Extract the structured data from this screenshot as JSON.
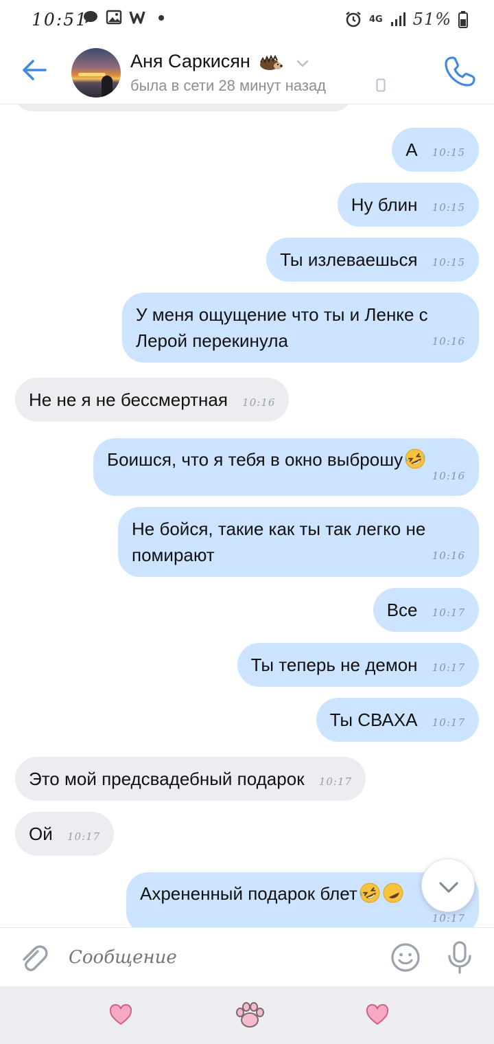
{
  "status_bar": {
    "time": "10:51",
    "network": "4G",
    "battery": "51%",
    "icons": [
      "message-icon",
      "gallery-icon",
      "w-icon",
      "dot-icon",
      "alarm-icon",
      "signal-icon",
      "battery-icon"
    ]
  },
  "header": {
    "contact_name": "Аня Саркисян",
    "name_emoji": "hedgehog-emoji",
    "status": "была в сети 28 минут назад",
    "accent_color": "#3f8ae0"
  },
  "messages": [
    {
      "dir": "out",
      "text": "А",
      "time": "10:15"
    },
    {
      "dir": "out",
      "text": "Ну блин",
      "time": "10:15"
    },
    {
      "dir": "out",
      "text": "Ты излеваешься",
      "time": "10:15"
    },
    {
      "dir": "out",
      "text_line1": "У меня ощущение что ты и Ленке с",
      "text_line2": "Лерой перекинула",
      "time": "10:16"
    },
    {
      "dir": "in",
      "text": "Не не я не бессмертная",
      "time": "10:16"
    },
    {
      "dir": "out",
      "text": "Боишся, что я тебя в окно выброшу",
      "emoji": "rofl-emoji",
      "time": "10:16"
    },
    {
      "dir": "out",
      "text_line1": "Не бойся, такие как ты так легко не",
      "text_line2": "помирают",
      "time": "10:16"
    },
    {
      "dir": "out",
      "text": "Все",
      "time": "10:17"
    },
    {
      "dir": "out",
      "text": "Ты теперь не демон",
      "time": "10:17"
    },
    {
      "dir": "out",
      "text": "Ты СВАХА",
      "time": "10:17"
    },
    {
      "dir": "in",
      "text": "Это мой предсвадебный подарок",
      "time": "10:17"
    },
    {
      "dir": "in",
      "text": "Ой",
      "time": "10:17"
    },
    {
      "dir": "out",
      "text": "Ахрененный подарок блет",
      "emoji": "rofl-emoji",
      "time": "10:17"
    }
  ],
  "input": {
    "placeholder": "Сообщение"
  },
  "colors": {
    "outgoing_bubble": "#cce4ff",
    "incoming_bubble": "#ebedf0",
    "accent": "#3f8ae0",
    "icon_gray": "#99a2ad",
    "keyboard_strip": "#eeeef2"
  }
}
